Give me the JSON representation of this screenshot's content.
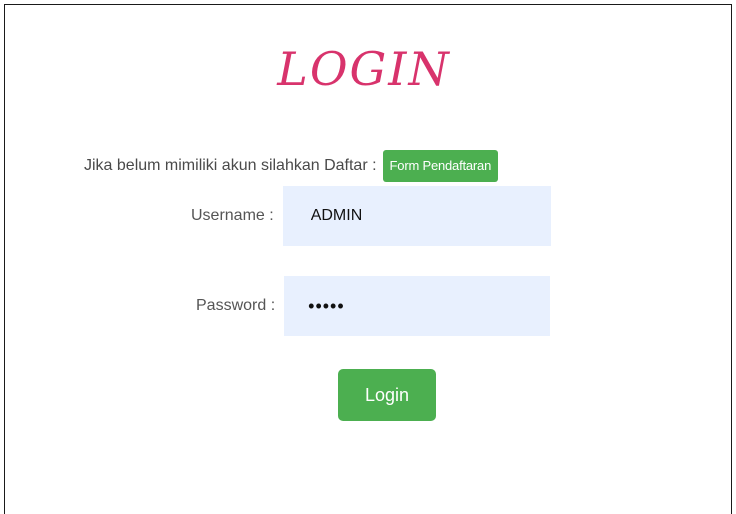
{
  "page": {
    "title": "LOGIN"
  },
  "register": {
    "prompt": "Jika belum mimiliki akun silahkan Daftar :",
    "button_label": "Form Pendaftaran"
  },
  "form": {
    "username": {
      "label": "Username :",
      "value": "ADMIN"
    },
    "password": {
      "label": "Password :",
      "value": "•••••"
    },
    "submit_label": "Login"
  },
  "colors": {
    "title": "#d8336c",
    "button": "#4caf50",
    "input_bg": "#e8f0fe"
  }
}
